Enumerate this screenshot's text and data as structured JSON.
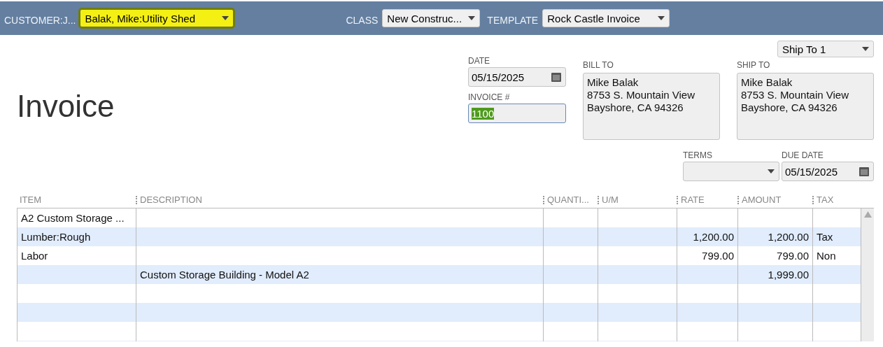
{
  "toolbar": {
    "fields": [
      {
        "label": "CUSTOMER:J...",
        "value": "Balak, Mike:Utility Shed",
        "highlighted": true
      },
      {
        "label": "CLASS",
        "value": "New Construc...",
        "highlighted": false
      },
      {
        "label": "TEMPLATE",
        "value": "Rock Castle Invoice",
        "highlighted": false
      }
    ]
  },
  "title": "Invoice",
  "date": {
    "label": "DATE",
    "value": "05/15/2025"
  },
  "invoice_number": {
    "label": "INVOICE #",
    "value": "1100",
    "text_selected": true
  },
  "bill_to": {
    "label": "BILL TO",
    "lines": [
      "Mike Balak",
      "8753 S. Mountain View",
      "Bayshore, CA  94326"
    ]
  },
  "ship_to": {
    "label": "SHIP TO",
    "selector": "Ship To 1",
    "lines": [
      "Mike Balak",
      "8753 S. Mountain View",
      "Bayshore, CA 94326"
    ]
  },
  "terms": {
    "label": "TERMS"
  },
  "due_date": {
    "label": "DUE DATE",
    "value": "05/15/2025"
  },
  "table": {
    "columns": [
      "ITEM",
      "DESCRIPTION",
      "QUANTI...",
      "U/M",
      "RATE",
      "AMOUNT",
      "TAX"
    ],
    "rows": [
      {
        "item": "A2 Custom Storage ..."
      },
      {
        "item": "Lumber:Rough",
        "rate": "1,200.00",
        "amount": "1,200.00",
        "tax": "Tax"
      },
      {
        "item": "Labor",
        "rate": "799.00",
        "amount": "799.00",
        "tax": "Non"
      },
      {
        "description": "Custom Storage Building - Model A2",
        "amount": "1,999.00"
      }
    ]
  }
}
